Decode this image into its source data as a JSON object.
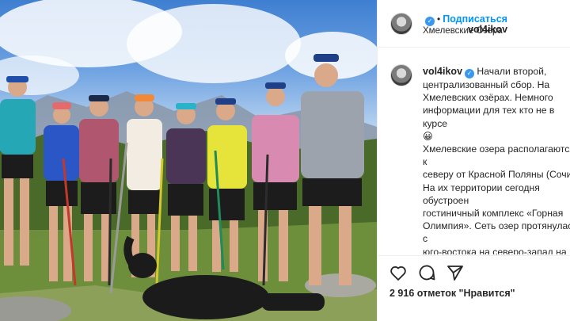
{
  "header": {
    "username": "vol4ikov",
    "separator": "•",
    "follow_label": "Подписаться",
    "location": "Хмелевские Озера"
  },
  "caption": {
    "username": "vol4ikov",
    "text": "Начали второй,\nцентрализованный сбор. На\nХмелевских озёрах. Немного\nинформации для тех кто не в курсе\n😀\nХмелевские озера располагаются к\nсеверу от Красной Поляны (Сочи).\nНа их территории сегодня обустроен\nгостиничный комплекс «Горная\nОлимпия». Сеть озер протянулась с\nюго-востока на северо-запад на\nобширной и плоской среднегорной\nпригребневой\nвозвышенности хребта Ачишхо, к\nвостоку от крутых спусков массива"
  },
  "actions": {
    "like_icon": "heart-icon",
    "comment_icon": "comment-icon",
    "share_icon": "share-icon",
    "likes_text": "2 916 отметок \"Нравится\""
  },
  "colors": {
    "link_blue": "#0095f6",
    "verified_blue": "#3897f0",
    "border": "#efefef",
    "text": "#262626"
  },
  "photo": {
    "description_icon": "group-photo"
  }
}
